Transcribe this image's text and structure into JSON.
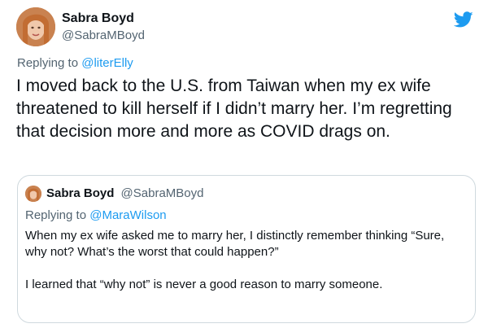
{
  "tweet": {
    "display_name": "Sabra Boyd",
    "handle": "@SabraMBoyd",
    "replying_prefix": "Replying to",
    "replying_to": "@literElly",
    "text": "I moved back to the U.S. from Taiwan when my ex wife threatened to kill herself if I didn’t marry her. I’m regretting that decision more and more as COVID drags on."
  },
  "quoted": {
    "display_name": "Sabra Boyd",
    "handle": "@SabraMBoyd",
    "replying_prefix": "Replying to",
    "replying_to": "@MaraWilson",
    "paragraphs": [
      "When my ex wife asked me to marry her, I distinctly remember thinking “Sure, why not? What’s the worst that could happen?”",
      "I learned that “why not” is never a good reason to marry someone."
    ]
  },
  "colors": {
    "accent": "#1d9bf0",
    "text": "#0f1419",
    "muted": "#536471",
    "border": "#cfd9de"
  },
  "icons": {
    "brand": "twitter-bird-icon"
  }
}
